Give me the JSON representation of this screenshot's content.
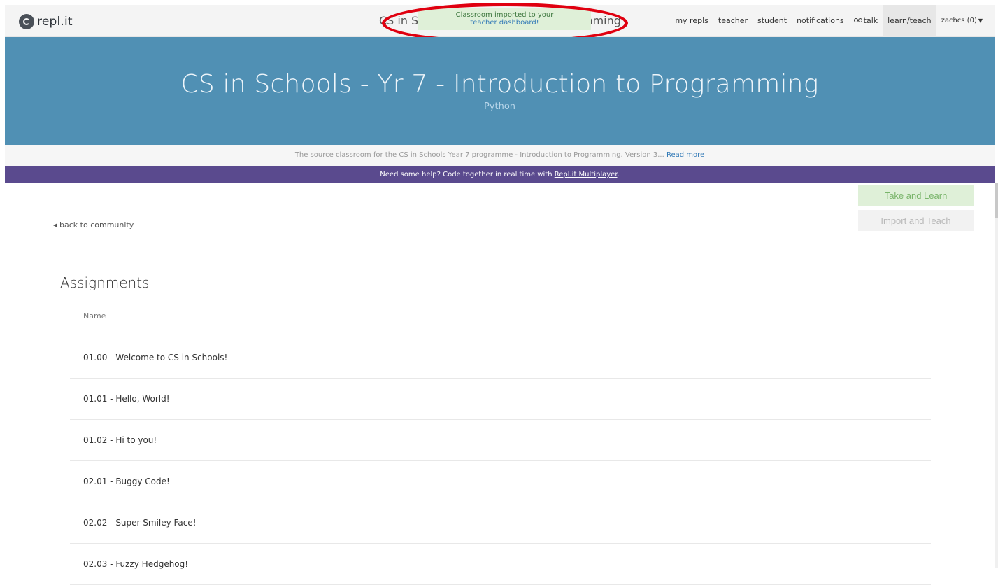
{
  "navbar": {
    "logo_text": "repl.it",
    "title_left": "CS in Sc",
    "title_right": "mming",
    "links": [
      "my repls",
      "teacher",
      "student",
      "notifications",
      "talk",
      "learn/teach",
      "zachcs (0)"
    ]
  },
  "flash": {
    "line1": "Classroom imported to your",
    "line2": "teacher dashboard!"
  },
  "banner": {
    "title": "CS in Schools - Yr 7 - Introduction to Programming",
    "language": "Python"
  },
  "description": {
    "text": "The source classroom for the CS in Schools Year 7 programme - Introduction to Programming. Version 3...",
    "read_more": "Read more"
  },
  "help": {
    "text": "Need some help? Code together in real time with",
    "link": "Repl.it Multiplayer",
    "suffix": "."
  },
  "buttons": {
    "take": "Take and Learn",
    "import": "Import and Teach"
  },
  "back_link": "back to community",
  "assignments": {
    "title": "Assignments",
    "column_name": "Name",
    "items": [
      "01.00 - Welcome to CS in Schools!",
      "01.01 - Hello, World!",
      "01.02 - Hi to you!",
      "02.01 - Buggy Code!",
      "02.02 - Super Smiley Face!",
      "02.03 - Fuzzy Hedgehog!"
    ]
  }
}
